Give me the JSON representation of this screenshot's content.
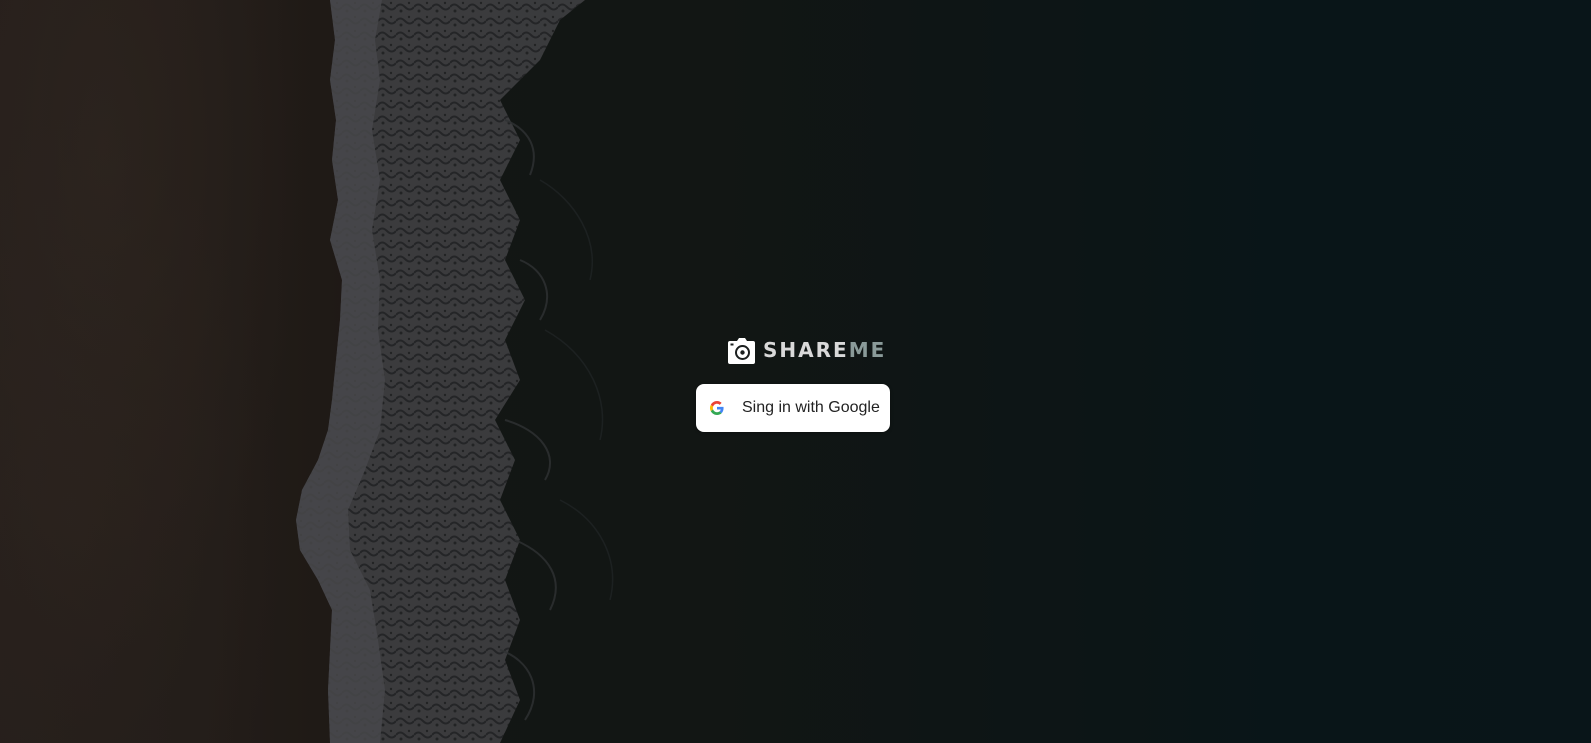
{
  "brand": {
    "name_primary": "SHARE",
    "name_secondary": "ME",
    "logo_icon": "camera-icon"
  },
  "auth": {
    "google_button_label": "Sing in with Google",
    "google_icon": "google-g-icon"
  },
  "colors": {
    "button_bg": "#ffffff",
    "button_text": "#222222",
    "logo_primary": "#d9d9d9",
    "logo_secondary": "#8a9a99",
    "background_dark": "#0c1b1f"
  }
}
